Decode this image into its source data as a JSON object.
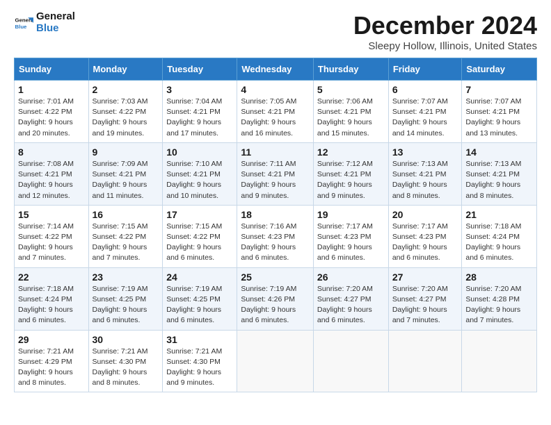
{
  "logo": {
    "line1": "General",
    "line2": "Blue"
  },
  "title": "December 2024",
  "location": "Sleepy Hollow, Illinois, United States",
  "days_of_week": [
    "Sunday",
    "Monday",
    "Tuesday",
    "Wednesday",
    "Thursday",
    "Friday",
    "Saturday"
  ],
  "weeks": [
    [
      {
        "day": 1,
        "sunrise": "7:01 AM",
        "sunset": "4:22 PM",
        "daylight": "9 hours and 20 minutes."
      },
      {
        "day": 2,
        "sunrise": "7:03 AM",
        "sunset": "4:22 PM",
        "daylight": "9 hours and 19 minutes."
      },
      {
        "day": 3,
        "sunrise": "7:04 AM",
        "sunset": "4:21 PM",
        "daylight": "9 hours and 17 minutes."
      },
      {
        "day": 4,
        "sunrise": "7:05 AM",
        "sunset": "4:21 PM",
        "daylight": "9 hours and 16 minutes."
      },
      {
        "day": 5,
        "sunrise": "7:06 AM",
        "sunset": "4:21 PM",
        "daylight": "9 hours and 15 minutes."
      },
      {
        "day": 6,
        "sunrise": "7:07 AM",
        "sunset": "4:21 PM",
        "daylight": "9 hours and 14 minutes."
      },
      {
        "day": 7,
        "sunrise": "7:07 AM",
        "sunset": "4:21 PM",
        "daylight": "9 hours and 13 minutes."
      }
    ],
    [
      {
        "day": 8,
        "sunrise": "7:08 AM",
        "sunset": "4:21 PM",
        "daylight": "9 hours and 12 minutes."
      },
      {
        "day": 9,
        "sunrise": "7:09 AM",
        "sunset": "4:21 PM",
        "daylight": "9 hours and 11 minutes."
      },
      {
        "day": 10,
        "sunrise": "7:10 AM",
        "sunset": "4:21 PM",
        "daylight": "9 hours and 10 minutes."
      },
      {
        "day": 11,
        "sunrise": "7:11 AM",
        "sunset": "4:21 PM",
        "daylight": "9 hours and 9 minutes."
      },
      {
        "day": 12,
        "sunrise": "7:12 AM",
        "sunset": "4:21 PM",
        "daylight": "9 hours and 9 minutes."
      },
      {
        "day": 13,
        "sunrise": "7:13 AM",
        "sunset": "4:21 PM",
        "daylight": "9 hours and 8 minutes."
      },
      {
        "day": 14,
        "sunrise": "7:13 AM",
        "sunset": "4:21 PM",
        "daylight": "9 hours and 8 minutes."
      }
    ],
    [
      {
        "day": 15,
        "sunrise": "7:14 AM",
        "sunset": "4:22 PM",
        "daylight": "9 hours and 7 minutes."
      },
      {
        "day": 16,
        "sunrise": "7:15 AM",
        "sunset": "4:22 PM",
        "daylight": "9 hours and 7 minutes."
      },
      {
        "day": 17,
        "sunrise": "7:15 AM",
        "sunset": "4:22 PM",
        "daylight": "9 hours and 6 minutes."
      },
      {
        "day": 18,
        "sunrise": "7:16 AM",
        "sunset": "4:23 PM",
        "daylight": "9 hours and 6 minutes."
      },
      {
        "day": 19,
        "sunrise": "7:17 AM",
        "sunset": "4:23 PM",
        "daylight": "9 hours and 6 minutes."
      },
      {
        "day": 20,
        "sunrise": "7:17 AM",
        "sunset": "4:23 PM",
        "daylight": "9 hours and 6 minutes."
      },
      {
        "day": 21,
        "sunrise": "7:18 AM",
        "sunset": "4:24 PM",
        "daylight": "9 hours and 6 minutes."
      }
    ],
    [
      {
        "day": 22,
        "sunrise": "7:18 AM",
        "sunset": "4:24 PM",
        "daylight": "9 hours and 6 minutes."
      },
      {
        "day": 23,
        "sunrise": "7:19 AM",
        "sunset": "4:25 PM",
        "daylight": "9 hours and 6 minutes."
      },
      {
        "day": 24,
        "sunrise": "7:19 AM",
        "sunset": "4:25 PM",
        "daylight": "9 hours and 6 minutes."
      },
      {
        "day": 25,
        "sunrise": "7:19 AM",
        "sunset": "4:26 PM",
        "daylight": "9 hours and 6 minutes."
      },
      {
        "day": 26,
        "sunrise": "7:20 AM",
        "sunset": "4:27 PM",
        "daylight": "9 hours and 6 minutes."
      },
      {
        "day": 27,
        "sunrise": "7:20 AM",
        "sunset": "4:27 PM",
        "daylight": "9 hours and 7 minutes."
      },
      {
        "day": 28,
        "sunrise": "7:20 AM",
        "sunset": "4:28 PM",
        "daylight": "9 hours and 7 minutes."
      }
    ],
    [
      {
        "day": 29,
        "sunrise": "7:21 AM",
        "sunset": "4:29 PM",
        "daylight": "9 hours and 8 minutes."
      },
      {
        "day": 30,
        "sunrise": "7:21 AM",
        "sunset": "4:30 PM",
        "daylight": "9 hours and 8 minutes."
      },
      {
        "day": 31,
        "sunrise": "7:21 AM",
        "sunset": "4:30 PM",
        "daylight": "9 hours and 9 minutes."
      },
      null,
      null,
      null,
      null
    ]
  ]
}
